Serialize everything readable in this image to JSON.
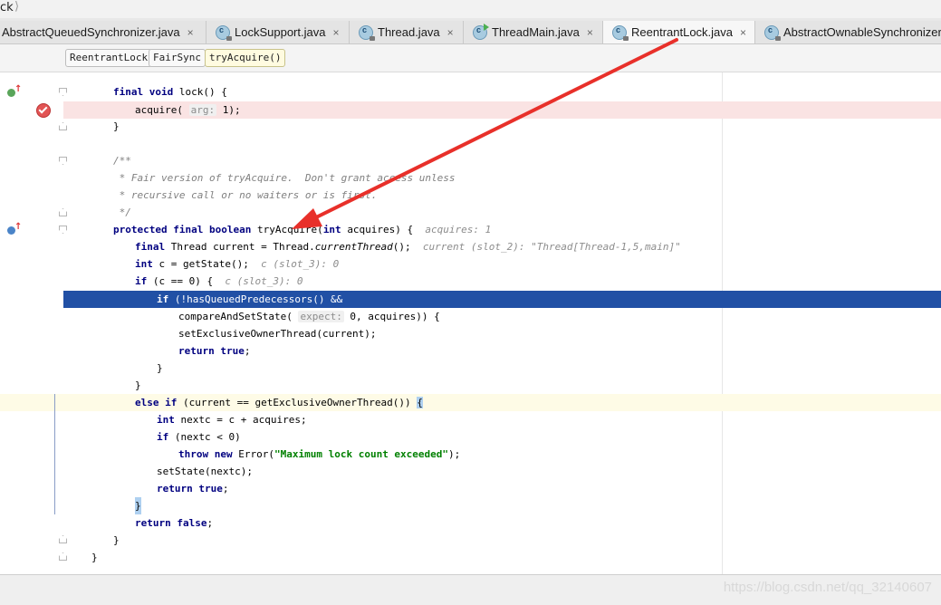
{
  "window": {
    "path_fragment": "ck",
    "path_separator": "⟩"
  },
  "tabs": [
    {
      "label": "AbstractQueuedSynchronizer.java",
      "icon": "class-icon",
      "close": "×",
      "active": false
    },
    {
      "label": "LockSupport.java",
      "icon": "class-icon",
      "close": "×",
      "active": false
    },
    {
      "label": "Thread.java",
      "icon": "class-icon",
      "close": "×",
      "active": false
    },
    {
      "label": "ThreadMain.java",
      "icon": "runnable-class-icon",
      "close": "×",
      "active": false
    },
    {
      "label": "ReentrantLock.java",
      "icon": "class-icon",
      "close": "×",
      "active": true
    },
    {
      "label": "AbstractOwnableSynchronizer",
      "icon": "class-icon",
      "close": "",
      "active": false
    }
  ],
  "breadcrumbs": [
    "ReentrantLock",
    "FairSync",
    "tryAcquire()"
  ],
  "code": {
    "l1": {
      "kw1": "final void ",
      "rest": "lock() {"
    },
    "l2": {
      "pre": "acquire( ",
      "hint": "arg:",
      "post": " 1);"
    },
    "l3": "}",
    "l5": "/**",
    "l6": " * Fair version of tryAcquire.  Don't grant access unless",
    "l7": " * recursive call or no waiters or is first.",
    "l8": " */",
    "l9": {
      "kw": "protected final boolean ",
      "name": "tryAcquire(",
      "kw2": "int ",
      "rest": "acquires) {",
      "hint": "acquires: 1"
    },
    "l10": {
      "kw": "final ",
      "type": "Thread current = Thread.",
      "call": "currentThread",
      "rest": "();",
      "hint": "current (slot_2): \"Thread[Thread-1,5,main]\""
    },
    "l11": {
      "kw": "int ",
      "rest": "c = getState();",
      "hint": "c (slot_3): 0"
    },
    "l12": {
      "kw": "if ",
      "rest": "(c == 0) {",
      "hint": "c (slot_3): 0"
    },
    "l13": {
      "kw": "if ",
      "rest": "(!hasQueuedPredecessors() &&"
    },
    "l14": {
      "pre": "compareAndSetState( ",
      "hint": "expect:",
      "post": " 0, acquires)) {"
    },
    "l15": "setExclusiveOwnerThread(current);",
    "l16": {
      "kw": "return true",
      "rest": ";"
    },
    "l17": "}",
    "l18": "}",
    "l19": {
      "kw": "else if ",
      "rest": "(current == getExclusiveOwnerThread()) ",
      "brace": "{"
    },
    "l20": {
      "kw": "int ",
      "rest": "nextc = c + acquires;"
    },
    "l21": {
      "kw": "if ",
      "rest": "(nextc < 0)"
    },
    "l22": {
      "kw": "throw new ",
      "rest": "Error(",
      "str": "\"Maximum lock count exceeded\"",
      "end": ");"
    },
    "l23": "setState(nextc);",
    "l24": {
      "kw": "return true",
      "rest": ";"
    },
    "l25": "}",
    "l26": {
      "kw": "return false",
      "rest": ";"
    },
    "l27": "}",
    "l28": "}"
  },
  "watermark": "https://blog.csdn.net/qq_32140607",
  "colors": {
    "current_line": "#2150a5",
    "breakpoint_line": "#fae3e3",
    "annotation_arrow": "#e8302a"
  }
}
